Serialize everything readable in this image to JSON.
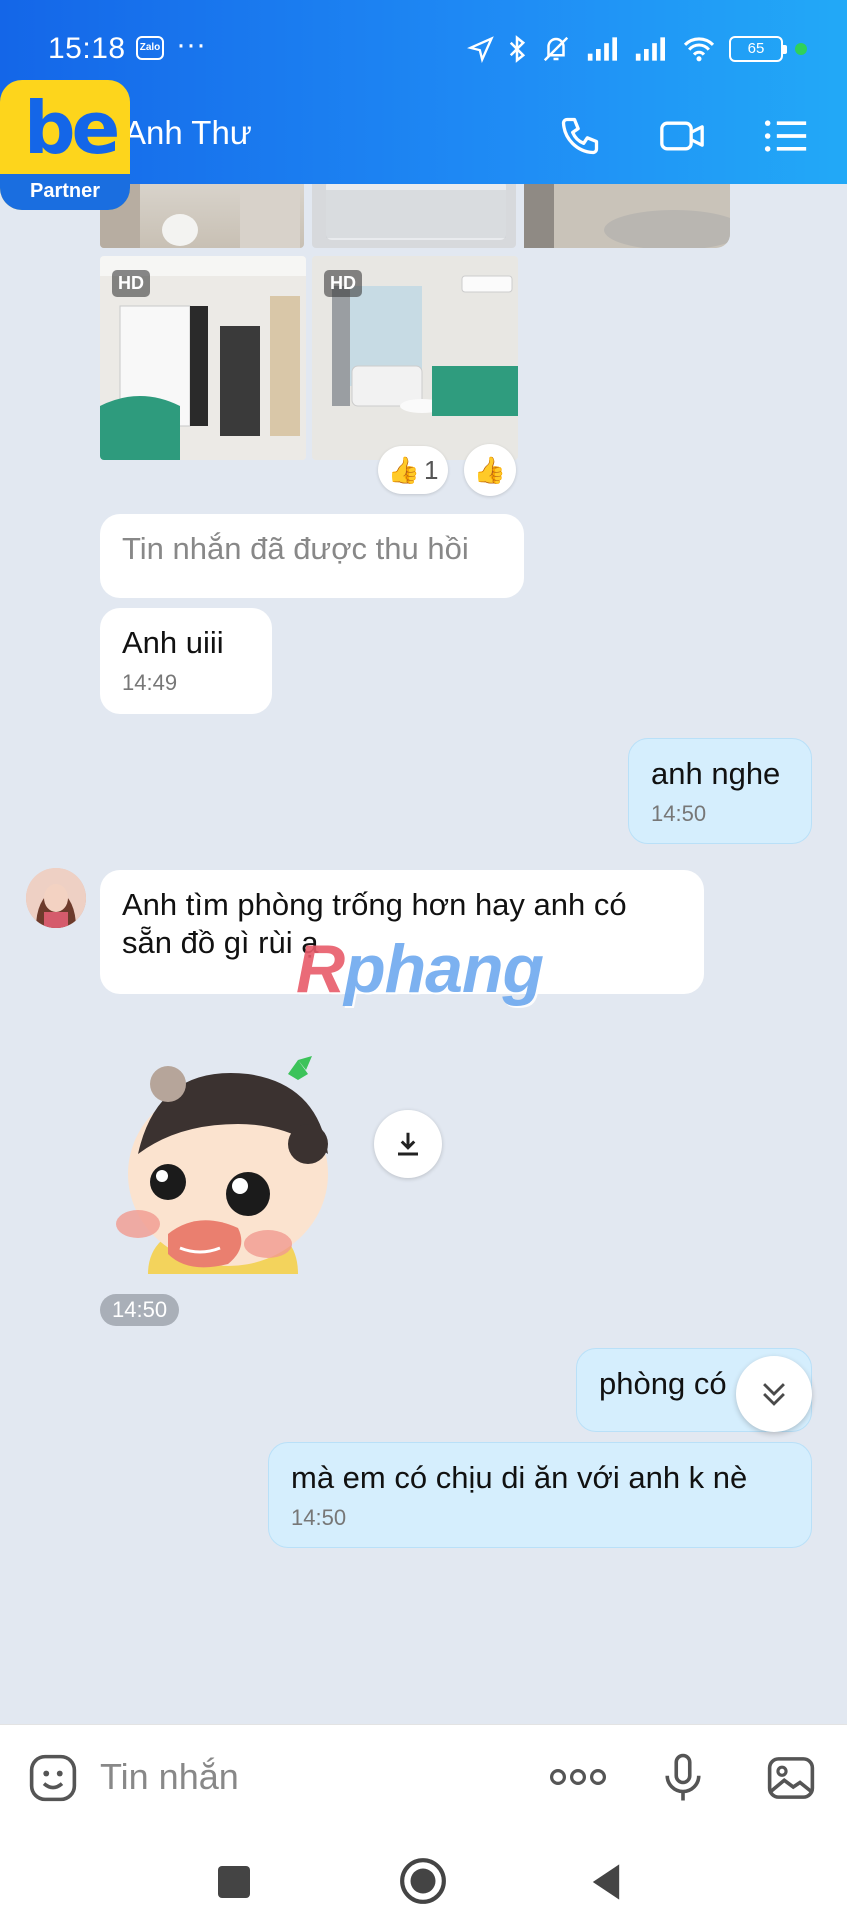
{
  "status_bar": {
    "time": "15:18",
    "app_badge": "Zalo",
    "more": "···",
    "battery": "65"
  },
  "header": {
    "title": "Anh Thư"
  },
  "overlay_logo": {
    "brand": "be",
    "label": "Partner"
  },
  "photos": {
    "hd_label": "HD"
  },
  "reactions": {
    "like_count": "1"
  },
  "messages": {
    "recalled": "Tin nhắn đã được thu hồi",
    "m1": {
      "text": "Anh uiii",
      "time": "14:49"
    },
    "m2": {
      "text": "anh nghe",
      "time": "14:50"
    },
    "m3": {
      "text": "Anh tìm phòng trống hơn hay anh có sẵn đồ gì rùi ạ"
    },
    "sticker_time": "14:50",
    "m4": {
      "text": "phòng có"
    },
    "m5": {
      "text": "mà em có chịu di ăn với anh k nè",
      "time": "14:50"
    }
  },
  "watermark": {
    "first": "R",
    "rest": "phang"
  },
  "composer": {
    "placeholder": "Tin nhắn",
    "more": "ooo"
  },
  "colors": {
    "header_blue": "#1466e8",
    "bubble_out": "#d5eefd",
    "bubble_in": "#ffffff",
    "chat_bg": "#e2e8f1"
  }
}
